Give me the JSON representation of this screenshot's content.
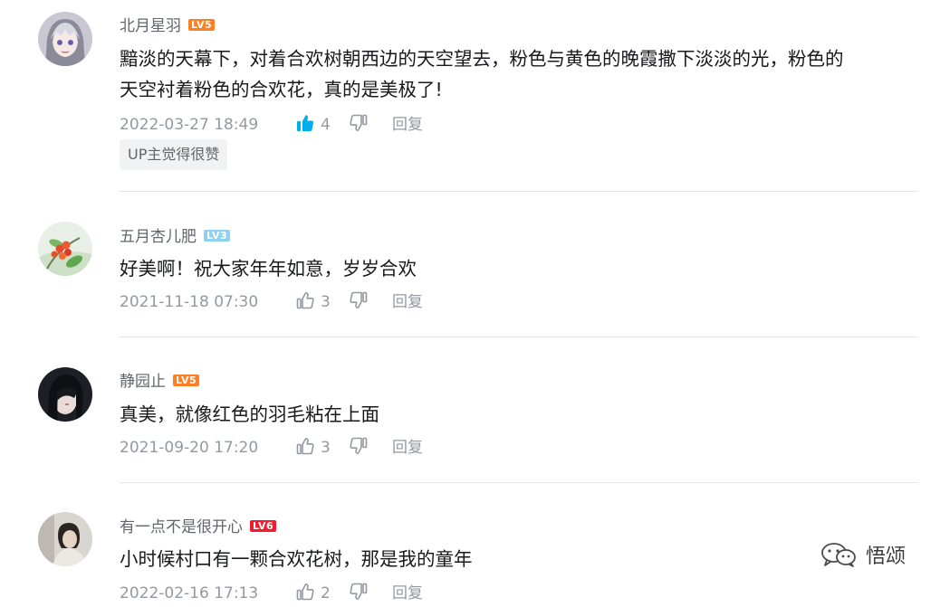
{
  "comments": [
    {
      "username": "北月星羽",
      "level": "LV5",
      "level_color": "#ff7f24",
      "text_lines": [
        "黯淡的天幕下，对着合欢树朝西边的天空望去，粉色与黄色的晚霞撒下淡淡的光，粉色的",
        "天空衬着粉色的合欢花，真的是美极了!"
      ],
      "date": "2022-03-27 18:49",
      "likes": "4",
      "liked": true,
      "reply_label": "回复",
      "badge": "UP主觉得很赞"
    },
    {
      "username": "五月杏儿肥",
      "level": "LV3",
      "level_color": "#8ed2f0",
      "text_lines": [
        "好美啊！祝大家年年如意，岁岁合欢"
      ],
      "date": "2021-11-18 07:30",
      "likes": "3",
      "liked": false,
      "reply_label": "回复"
    },
    {
      "username": "静园止",
      "level": "LV5",
      "level_color": "#ff7f24",
      "text_lines": [
        "真美，就像红色的羽毛粘在上面"
      ],
      "date": "2021-09-20 17:20",
      "likes": "3",
      "liked": false,
      "reply_label": "回复"
    },
    {
      "username": "有一点不是很开心",
      "level": "LV6",
      "level_color": "#f21c2e",
      "text_lines": [
        "小时候村口有一颗合欢花树，那是我的童年"
      ],
      "date": "2022-02-16 17:13",
      "likes": "2",
      "liked": false,
      "reply_label": "回复"
    }
  ],
  "watermark": {
    "icon": "wechat-icon",
    "text": "悟颂"
  }
}
